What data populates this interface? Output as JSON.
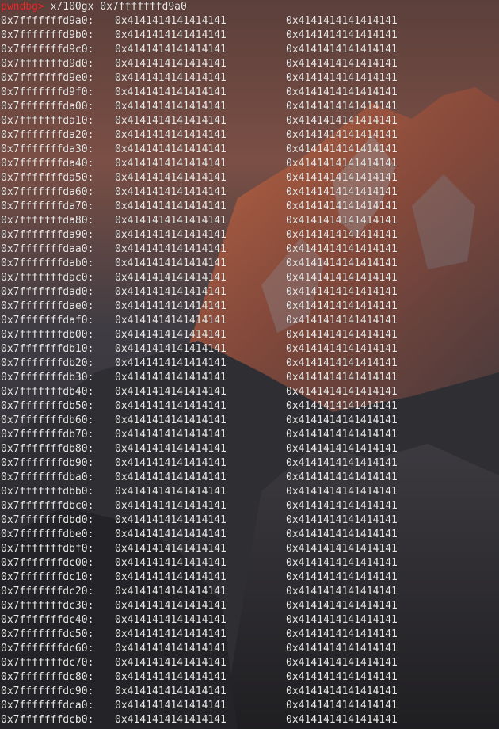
{
  "terminal": {
    "prompt_label": "pwndbg>",
    "command": " x/100gx 0x7fffffffd9a0",
    "rows": [
      {
        "addr": "0x7fffffffd9a0:",
        "v1": "0x4141414141414141",
        "v2": "0x4141414141414141"
      },
      {
        "addr": "0x7fffffffd9b0:",
        "v1": "0x4141414141414141",
        "v2": "0x4141414141414141"
      },
      {
        "addr": "0x7fffffffd9c0:",
        "v1": "0x4141414141414141",
        "v2": "0x4141414141414141"
      },
      {
        "addr": "0x7fffffffd9d0:",
        "v1": "0x4141414141414141",
        "v2": "0x4141414141414141"
      },
      {
        "addr": "0x7fffffffd9e0:",
        "v1": "0x4141414141414141",
        "v2": "0x4141414141414141"
      },
      {
        "addr": "0x7fffffffd9f0:",
        "v1": "0x4141414141414141",
        "v2": "0x4141414141414141"
      },
      {
        "addr": "0x7fffffffda00:",
        "v1": "0x4141414141414141",
        "v2": "0x4141414141414141"
      },
      {
        "addr": "0x7fffffffda10:",
        "v1": "0x4141414141414141",
        "v2": "0x4141414141414141"
      },
      {
        "addr": "0x7fffffffda20:",
        "v1": "0x4141414141414141",
        "v2": "0x4141414141414141"
      },
      {
        "addr": "0x7fffffffda30:",
        "v1": "0x4141414141414141",
        "v2": "0x4141414141414141"
      },
      {
        "addr": "0x7fffffffda40:",
        "v1": "0x4141414141414141",
        "v2": "0x4141414141414141"
      },
      {
        "addr": "0x7fffffffda50:",
        "v1": "0x4141414141414141",
        "v2": "0x4141414141414141"
      },
      {
        "addr": "0x7fffffffda60:",
        "v1": "0x4141414141414141",
        "v2": "0x4141414141414141"
      },
      {
        "addr": "0x7fffffffda70:",
        "v1": "0x4141414141414141",
        "v2": "0x4141414141414141"
      },
      {
        "addr": "0x7fffffffda80:",
        "v1": "0x4141414141414141",
        "v2": "0x4141414141414141"
      },
      {
        "addr": "0x7fffffffda90:",
        "v1": "0x4141414141414141",
        "v2": "0x4141414141414141"
      },
      {
        "addr": "0x7fffffffdaa0:",
        "v1": "0x4141414141414141",
        "v2": "0x4141414141414141"
      },
      {
        "addr": "0x7fffffffdab0:",
        "v1": "0x4141414141414141",
        "v2": "0x4141414141414141"
      },
      {
        "addr": "0x7fffffffdac0:",
        "v1": "0x4141414141414141",
        "v2": "0x4141414141414141"
      },
      {
        "addr": "0x7fffffffdad0:",
        "v1": "0x4141414141414141",
        "v2": "0x4141414141414141"
      },
      {
        "addr": "0x7fffffffdae0:",
        "v1": "0x4141414141414141",
        "v2": "0x4141414141414141"
      },
      {
        "addr": "0x7fffffffdaf0:",
        "v1": "0x4141414141414141",
        "v2": "0x4141414141414141"
      },
      {
        "addr": "0x7fffffffdb00:",
        "v1": "0x4141414141414141",
        "v2": "0x4141414141414141"
      },
      {
        "addr": "0x7fffffffdb10:",
        "v1": "0x4141414141414141",
        "v2": "0x4141414141414141"
      },
      {
        "addr": "0x7fffffffdb20:",
        "v1": "0x4141414141414141",
        "v2": "0x4141414141414141"
      },
      {
        "addr": "0x7fffffffdb30:",
        "v1": "0x4141414141414141",
        "v2": "0x4141414141414141"
      },
      {
        "addr": "0x7fffffffdb40:",
        "v1": "0x4141414141414141",
        "v2": "0x4141414141414141"
      },
      {
        "addr": "0x7fffffffdb50:",
        "v1": "0x4141414141414141",
        "v2": "0x4141414141414141"
      },
      {
        "addr": "0x7fffffffdb60:",
        "v1": "0x4141414141414141",
        "v2": "0x4141414141414141"
      },
      {
        "addr": "0x7fffffffdb70:",
        "v1": "0x4141414141414141",
        "v2": "0x4141414141414141"
      },
      {
        "addr": "0x7fffffffdb80:",
        "v1": "0x4141414141414141",
        "v2": "0x4141414141414141"
      },
      {
        "addr": "0x7fffffffdb90:",
        "v1": "0x4141414141414141",
        "v2": "0x4141414141414141"
      },
      {
        "addr": "0x7fffffffdba0:",
        "v1": "0x4141414141414141",
        "v2": "0x4141414141414141"
      },
      {
        "addr": "0x7fffffffdbb0:",
        "v1": "0x4141414141414141",
        "v2": "0x4141414141414141"
      },
      {
        "addr": "0x7fffffffdbc0:",
        "v1": "0x4141414141414141",
        "v2": "0x4141414141414141"
      },
      {
        "addr": "0x7fffffffdbd0:",
        "v1": "0x4141414141414141",
        "v2": "0x4141414141414141"
      },
      {
        "addr": "0x7fffffffdbe0:",
        "v1": "0x4141414141414141",
        "v2": "0x4141414141414141"
      },
      {
        "addr": "0x7fffffffdbf0:",
        "v1": "0x4141414141414141",
        "v2": "0x4141414141414141"
      },
      {
        "addr": "0x7fffffffdc00:",
        "v1": "0x4141414141414141",
        "v2": "0x4141414141414141"
      },
      {
        "addr": "0x7fffffffdc10:",
        "v1": "0x4141414141414141",
        "v2": "0x4141414141414141"
      },
      {
        "addr": "0x7fffffffdc20:",
        "v1": "0x4141414141414141",
        "v2": "0x4141414141414141"
      },
      {
        "addr": "0x7fffffffdc30:",
        "v1": "0x4141414141414141",
        "v2": "0x4141414141414141"
      },
      {
        "addr": "0x7fffffffdc40:",
        "v1": "0x4141414141414141",
        "v2": "0x4141414141414141"
      },
      {
        "addr": "0x7fffffffdc50:",
        "v1": "0x4141414141414141",
        "v2": "0x4141414141414141"
      },
      {
        "addr": "0x7fffffffdc60:",
        "v1": "0x4141414141414141",
        "v2": "0x4141414141414141"
      },
      {
        "addr": "0x7fffffffdc70:",
        "v1": "0x4141414141414141",
        "v2": "0x4141414141414141"
      },
      {
        "addr": "0x7fffffffdc80:",
        "v1": "0x4141414141414141",
        "v2": "0x4141414141414141"
      },
      {
        "addr": "0x7fffffffdc90:",
        "v1": "0x4141414141414141",
        "v2": "0x4141414141414141"
      },
      {
        "addr": "0x7fffffffdca0:",
        "v1": "0x4141414141414141",
        "v2": "0x4141414141414141"
      },
      {
        "addr": "0x7fffffffdcb0:",
        "v1": "0x4141414141414141",
        "v2": "0x4141414141414141"
      }
    ]
  },
  "colors": {
    "prompt": "#ef2929",
    "text": "#e9e9e7"
  }
}
